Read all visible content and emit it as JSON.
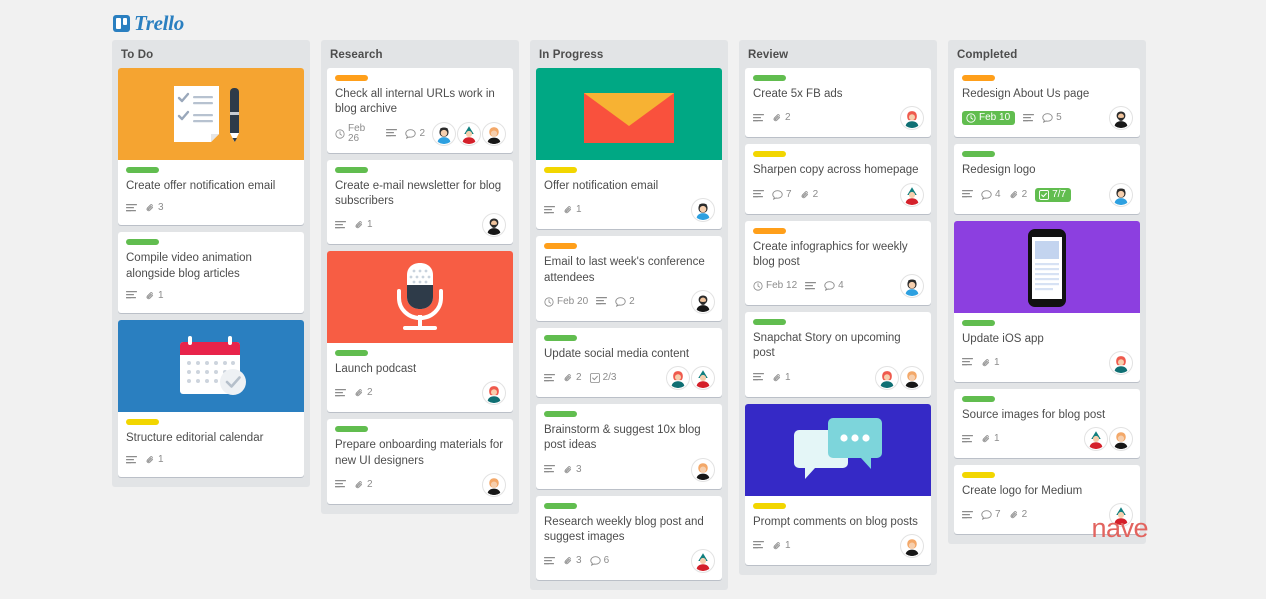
{
  "app": {
    "logo_text": "Trello",
    "watermark": "nave",
    "background_color": "#f1f1f1",
    "column_color": "#e2e4e6",
    "card_color": "#ffffff",
    "label_colors": {
      "green": "#61bd4f",
      "yellow": "#f2d600",
      "orange": "#ffab4a",
      "dark_orange": "#ff9f1a"
    },
    "accent_color": "#2a7fc0"
  },
  "columns": [
    {
      "title": "To Do",
      "cards": [
        {
          "cover": "checklist-pen",
          "cover_bg": "#f5a431",
          "label": "green",
          "title": "Create offer notification email",
          "badges": [
            {
              "type": "description"
            },
            {
              "type": "attachment",
              "count": "3"
            }
          ],
          "avatars": []
        },
        {
          "label": "green",
          "title": "Compile video animation alongside blog articles",
          "badges": [
            {
              "type": "description"
            },
            {
              "type": "attachment",
              "count": "1"
            }
          ],
          "avatars": []
        },
        {
          "cover": "calendar-check",
          "cover_bg": "#2a7fc0",
          "label": "yellow",
          "title": "Structure editorial calendar",
          "badges": [
            {
              "type": "description"
            },
            {
              "type": "attachment",
              "count": "1"
            }
          ],
          "avatars": []
        }
      ]
    },
    {
      "title": "Research",
      "cards": [
        {
          "label": "dark_orange",
          "title": "Check all internal URLs work in blog archive",
          "badges": [
            {
              "type": "due",
              "text": "Feb 26"
            },
            {
              "type": "description"
            },
            {
              "type": "comment",
              "count": "2"
            }
          ],
          "avatars": [
            "dark-hair-blue",
            "teal-hair-red",
            "ginger-black"
          ]
        },
        {
          "label": "green",
          "title": "Create e-mail newsletter for blog subscribers",
          "badges": [
            {
              "type": "description"
            },
            {
              "type": "attachment",
              "count": "1"
            }
          ],
          "avatars": [
            "beard-dark"
          ]
        },
        {
          "cover": "microphone",
          "cover_bg": "#f75d44",
          "label": "green",
          "title": "Launch podcast",
          "badges": [
            {
              "type": "description"
            },
            {
              "type": "attachment",
              "count": "2"
            }
          ],
          "avatars": [
            "red-hair-teal"
          ]
        },
        {
          "label": "green",
          "title": "Prepare onboarding materials for new UI designers",
          "badges": [
            {
              "type": "description"
            },
            {
              "type": "attachment",
              "count": "2"
            }
          ],
          "avatars": [
            "ginger-black"
          ]
        }
      ]
    },
    {
      "title": "In Progress",
      "cards": [
        {
          "cover": "envelope",
          "cover_bg": "#00a884",
          "label": "yellow",
          "title": "Offer notification email",
          "badges": [
            {
              "type": "description"
            },
            {
              "type": "attachment",
              "count": "1"
            }
          ],
          "avatars": [
            "dark-hair-blue"
          ]
        },
        {
          "label": "dark_orange",
          "title": "Email to last week's conference attendees",
          "badges": [
            {
              "type": "due",
              "text": "Feb 20"
            },
            {
              "type": "description"
            },
            {
              "type": "comment",
              "count": "2"
            }
          ],
          "avatars": [
            "beard-dark"
          ]
        },
        {
          "label": "green",
          "title": "Update social media content",
          "badges": [
            {
              "type": "description"
            },
            {
              "type": "attachment",
              "count": "2"
            },
            {
              "type": "checklist",
              "text": "2/3"
            }
          ],
          "avatars": [
            "red-hair-teal",
            "teal-hair-red"
          ]
        },
        {
          "label": "green",
          "title": "Brainstorm & suggest 10x blog post ideas",
          "badges": [
            {
              "type": "description"
            },
            {
              "type": "attachment",
              "count": "3"
            }
          ],
          "avatars": [
            "ginger-black"
          ]
        },
        {
          "label": "green",
          "title": "Research weekly blog post and suggest images",
          "badges": [
            {
              "type": "description"
            },
            {
              "type": "attachment",
              "count": "3"
            },
            {
              "type": "comment",
              "count": "6"
            }
          ],
          "avatars": [
            "teal-hair-red"
          ]
        }
      ]
    },
    {
      "title": "Review",
      "cards": [
        {
          "label": "green",
          "title": "Create 5x FB ads",
          "badges": [
            {
              "type": "description"
            },
            {
              "type": "attachment",
              "count": "2"
            }
          ],
          "avatars": [
            "red-hair-teal"
          ]
        },
        {
          "label": "yellow",
          "title": "Sharpen copy across homepage",
          "badges": [
            {
              "type": "description"
            },
            {
              "type": "comment",
              "count": "7"
            },
            {
              "type": "attachment",
              "count": "2"
            }
          ],
          "avatars": [
            "teal-hair-red"
          ]
        },
        {
          "label": "dark_orange",
          "title": "Create infographics for weekly blog post",
          "badges": [
            {
              "type": "due",
              "text": "Feb 12"
            },
            {
              "type": "description"
            },
            {
              "type": "comment",
              "count": "4"
            }
          ],
          "avatars": [
            "dark-hair-blue"
          ]
        },
        {
          "label": "green",
          "title": "Snapchat Story on upcoming post",
          "badges": [
            {
              "type": "description"
            },
            {
              "type": "attachment",
              "count": "1"
            }
          ],
          "avatars": [
            "red-hair-teal",
            "ginger-black"
          ]
        },
        {
          "cover": "chat-bubbles",
          "cover_bg": "#3529c6",
          "label": "yellow",
          "title": "Prompt comments on blog posts",
          "badges": [
            {
              "type": "description"
            },
            {
              "type": "attachment",
              "count": "1"
            }
          ],
          "avatars": [
            "ginger-black"
          ]
        }
      ]
    },
    {
      "title": "Completed",
      "cards": [
        {
          "label": "dark_orange",
          "title": "Redesign About Us page",
          "badges": [
            {
              "type": "due_done",
              "text": "Feb 10"
            },
            {
              "type": "description"
            },
            {
              "type": "comment",
              "count": "5"
            }
          ],
          "avatars": [
            "beard-dark"
          ]
        },
        {
          "label": "green",
          "title": "Redesign logo",
          "badges": [
            {
              "type": "description"
            },
            {
              "type": "comment",
              "count": "4"
            },
            {
              "type": "attachment",
              "count": "2"
            },
            {
              "type": "checklist_done",
              "text": "7/7"
            }
          ],
          "avatars": [
            "dark-hair-blue"
          ]
        },
        {
          "cover": "mobile-phone",
          "cover_bg": "#8c3fe0",
          "label": "green",
          "title": "Update iOS app",
          "badges": [
            {
              "type": "description"
            },
            {
              "type": "attachment",
              "count": "1"
            }
          ],
          "avatars": [
            "red-hair-teal"
          ]
        },
        {
          "label": "green",
          "title": "Source images for blog post",
          "badges": [
            {
              "type": "description"
            },
            {
              "type": "attachment",
              "count": "1"
            }
          ],
          "avatars": [
            "teal-hair-red",
            "ginger-black"
          ]
        },
        {
          "label": "yellow",
          "title": "Create logo for Medium",
          "badges": [
            {
              "type": "description"
            },
            {
              "type": "comment",
              "count": "7"
            },
            {
              "type": "attachment",
              "count": "2"
            }
          ],
          "avatars": [
            "teal-hair-red"
          ]
        }
      ]
    }
  ]
}
